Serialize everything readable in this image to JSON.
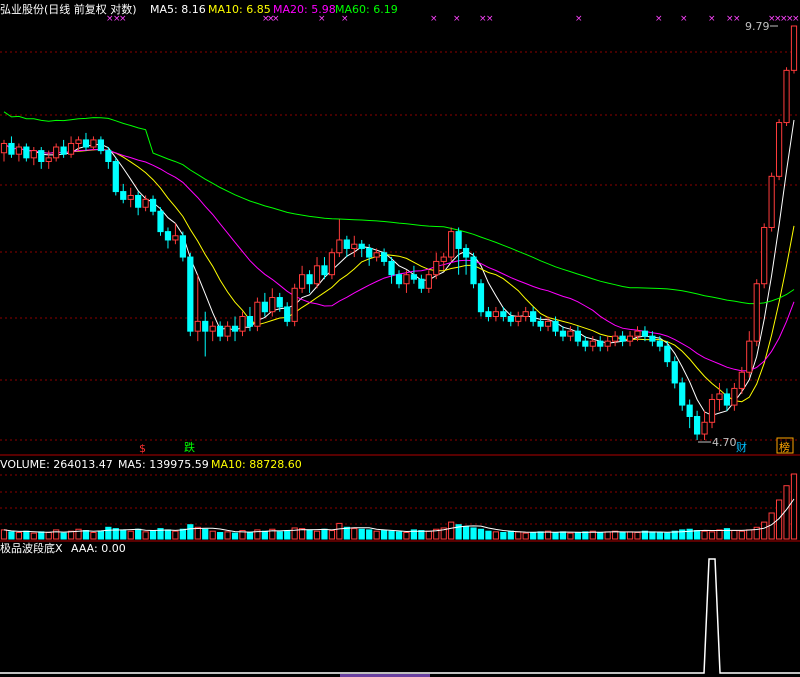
{
  "title_bar": {
    "name": "弘业股份(日线 前复权 对数)",
    "ma5": "MA5: 8.16",
    "ma10": "MA10: 6.85",
    "ma20": "MA20: 5.98",
    "ma60": "MA60: 6.19"
  },
  "price_panel": {
    "high_label": "9.79",
    "low_label": "4.70",
    "badge_cai": "财",
    "badge_bang": "榜",
    "marker_s": "$",
    "marker_die": "跌"
  },
  "volume_panel": {
    "label": "VOLUME: 264013.47",
    "ma5": "MA5: 139975.59",
    "ma10": "MA10: 88728.60"
  },
  "indicator_panel": {
    "label": "极品波段底X",
    "aaa": "AAA: 0.00"
  },
  "colors": {
    "up": "#ff3c3c",
    "down": "#00ffff",
    "ma5": "#ffffff",
    "ma10": "#ffff00",
    "ma20": "#ff00ff",
    "ma60": "#00ff00",
    "grid": "#8b0000"
  },
  "chart_data": {
    "type": "candlestick",
    "price_range": [
      4.7,
      9.79
    ],
    "candles": [
      [
        7.82,
        7.95,
        8.0,
        7.7
      ],
      [
        7.95,
        7.8,
        8.05,
        7.75
      ],
      [
        7.8,
        7.9,
        7.95,
        7.7
      ],
      [
        7.9,
        7.75,
        7.95,
        7.7
      ],
      [
        7.75,
        7.85,
        7.9,
        7.65
      ],
      [
        7.85,
        7.7,
        7.9,
        7.6
      ],
      [
        7.7,
        7.75,
        7.85,
        7.6
      ],
      [
        7.75,
        7.9,
        7.95,
        7.7
      ],
      [
        7.9,
        7.8,
        8.0,
        7.75
      ],
      [
        7.8,
        7.95,
        8.05,
        7.75
      ],
      [
        7.95,
        8.0,
        8.05,
        7.85
      ],
      [
        8.0,
        7.9,
        8.1,
        7.85
      ],
      [
        7.9,
        8.0,
        8.05,
        7.85
      ],
      [
        8.0,
        7.85,
        8.05,
        7.8
      ],
      [
        7.85,
        7.7,
        7.9,
        7.6
      ],
      [
        7.7,
        7.3,
        7.75,
        7.25
      ],
      [
        7.3,
        7.2,
        7.4,
        7.15
      ],
      [
        7.2,
        7.25,
        7.35,
        7.1
      ],
      [
        7.25,
        7.1,
        7.3,
        7.0
      ],
      [
        7.1,
        7.2,
        7.25,
        7.05
      ],
      [
        7.2,
        7.05,
        7.25,
        7.0
      ],
      [
        7.05,
        6.8,
        7.1,
        6.75
      ],
      [
        6.8,
        6.7,
        6.85,
        6.6
      ],
      [
        6.7,
        6.75,
        6.9,
        6.65
      ],
      [
        6.75,
        6.5,
        6.8,
        6.45
      ],
      [
        6.5,
        5.7,
        6.55,
        5.65
      ],
      [
        5.7,
        5.8,
        6.3,
        5.6
      ],
      [
        5.8,
        5.7,
        5.9,
        5.45
      ],
      [
        5.7,
        5.75,
        5.8,
        5.6
      ],
      [
        5.75,
        5.65,
        5.8,
        5.6
      ],
      [
        5.65,
        5.75,
        5.8,
        5.6
      ],
      [
        5.75,
        5.7,
        5.85,
        5.6
      ],
      [
        5.7,
        5.85,
        5.9,
        5.65
      ],
      [
        5.85,
        5.75,
        5.95,
        5.7
      ],
      [
        5.75,
        6.0,
        6.05,
        5.7
      ],
      [
        6.0,
        5.9,
        6.1,
        5.85
      ],
      [
        5.9,
        6.05,
        6.15,
        5.85
      ],
      [
        6.05,
        5.95,
        6.1,
        5.9
      ],
      [
        5.95,
        5.8,
        6.0,
        5.75
      ],
      [
        5.8,
        6.15,
        6.2,
        5.75
      ],
      [
        6.15,
        6.3,
        6.4,
        6.1
      ],
      [
        6.3,
        6.2,
        6.35,
        6.1
      ],
      [
        6.2,
        6.4,
        6.5,
        6.15
      ],
      [
        6.4,
        6.3,
        6.5,
        6.25
      ],
      [
        6.3,
        6.55,
        6.6,
        6.25
      ],
      [
        6.55,
        6.7,
        6.95,
        6.5
      ],
      [
        6.7,
        6.6,
        6.75,
        6.5
      ],
      [
        6.6,
        6.65,
        6.75,
        6.5
      ],
      [
        6.65,
        6.6,
        6.7,
        6.5
      ],
      [
        6.6,
        6.5,
        6.65,
        6.4
      ],
      [
        6.5,
        6.55,
        6.6,
        6.45
      ],
      [
        6.55,
        6.45,
        6.6,
        6.4
      ],
      [
        6.45,
        6.3,
        6.5,
        6.2
      ],
      [
        6.3,
        6.2,
        6.35,
        6.15
      ],
      [
        6.2,
        6.3,
        6.35,
        6.1
      ],
      [
        6.3,
        6.25,
        6.4,
        6.2
      ],
      [
        6.25,
        6.15,
        6.3,
        6.1
      ],
      [
        6.15,
        6.3,
        6.35,
        6.1
      ],
      [
        6.3,
        6.45,
        6.55,
        6.25
      ],
      [
        6.45,
        6.5,
        6.55,
        6.35
      ],
      [
        6.5,
        6.8,
        6.85,
        6.45
      ],
      [
        6.8,
        6.6,
        6.85,
        6.3
      ],
      [
        6.6,
        6.5,
        6.65,
        6.3
      ],
      [
        6.5,
        6.2,
        6.55,
        6.15
      ],
      [
        6.2,
        5.9,
        6.25,
        5.85
      ],
      [
        5.9,
        5.85,
        5.95,
        5.8
      ],
      [
        5.85,
        5.9,
        5.95,
        5.8
      ],
      [
        5.9,
        5.85,
        5.95,
        5.8
      ],
      [
        5.85,
        5.8,
        5.9,
        5.75
      ],
      [
        5.8,
        5.85,
        5.9,
        5.75
      ],
      [
        5.85,
        5.9,
        5.95,
        5.8
      ],
      [
        5.9,
        5.8,
        5.95,
        5.75
      ],
      [
        5.8,
        5.75,
        5.85,
        5.7
      ],
      [
        5.75,
        5.8,
        5.85,
        5.7
      ],
      [
        5.8,
        5.7,
        5.85,
        5.65
      ],
      [
        5.7,
        5.65,
        5.75,
        5.6
      ],
      [
        5.65,
        5.7,
        5.75,
        5.6
      ],
      [
        5.7,
        5.6,
        5.75,
        5.55
      ],
      [
        5.6,
        5.55,
        5.65,
        5.5
      ],
      [
        5.55,
        5.6,
        5.65,
        5.5
      ],
      [
        5.6,
        5.55,
        5.65,
        5.5
      ],
      [
        5.55,
        5.6,
        5.65,
        5.5
      ],
      [
        5.6,
        5.65,
        5.7,
        5.55
      ],
      [
        5.65,
        5.6,
        5.7,
        5.55
      ],
      [
        5.6,
        5.65,
        5.7,
        5.55
      ],
      [
        5.65,
        5.7,
        5.75,
        5.6
      ],
      [
        5.7,
        5.65,
        5.75,
        5.6
      ],
      [
        5.65,
        5.6,
        5.7,
        5.55
      ],
      [
        5.6,
        5.55,
        5.65,
        5.5
      ],
      [
        5.55,
        5.4,
        5.6,
        5.35
      ],
      [
        5.4,
        5.2,
        5.45,
        5.15
      ],
      [
        5.2,
        5.0,
        5.25,
        4.95
      ],
      [
        5.0,
        4.9,
        5.05,
        4.8
      ],
      [
        4.9,
        4.75,
        4.95,
        4.7
      ],
      [
        4.75,
        4.85,
        4.95,
        4.7
      ],
      [
        4.85,
        5.05,
        5.1,
        4.8
      ],
      [
        5.05,
        5.1,
        5.2,
        4.95
      ],
      [
        5.1,
        5.0,
        5.15,
        4.95
      ],
      [
        5.0,
        5.15,
        5.2,
        4.95
      ],
      [
        5.15,
        5.3,
        5.35,
        5.1
      ],
      [
        5.3,
        5.6,
        5.7,
        5.25
      ],
      [
        5.6,
        6.2,
        6.25,
        5.55
      ],
      [
        6.2,
        6.85,
        6.9,
        6.15
      ],
      [
        6.85,
        7.5,
        7.55,
        6.8
      ],
      [
        7.5,
        8.25,
        8.3,
        7.45
      ],
      [
        8.25,
        9.05,
        9.1,
        8.2
      ],
      [
        9.05,
        9.79,
        9.79,
        9.0
      ]
    ],
    "volumes": [
      14,
      11,
      10,
      12,
      9,
      11,
      10,
      14,
      9,
      12,
      15,
      13,
      10,
      12,
      18,
      16,
      14,
      12,
      15,
      11,
      13,
      16,
      14,
      12,
      15,
      22,
      18,
      15,
      12,
      10,
      11,
      9,
      13,
      10,
      14,
      12,
      15,
      11,
      13,
      17,
      16,
      14,
      12,
      15,
      13,
      24,
      18,
      16,
      15,
      14,
      12,
      13,
      12,
      11,
      10,
      14,
      13,
      12,
      15,
      17,
      26,
      22,
      19,
      17,
      15,
      12,
      11,
      10,
      12,
      11,
      9,
      10,
      11,
      12,
      10,
      11,
      9,
      10,
      11,
      12,
      10,
      11,
      12,
      10,
      11,
      10,
      12,
      11,
      10,
      9,
      12,
      14,
      15,
      13,
      12,
      11,
      14,
      16,
      13,
      12,
      14,
      18,
      26,
      40,
      60,
      82,
      100
    ],
    "aaa_spike_index": 95
  }
}
